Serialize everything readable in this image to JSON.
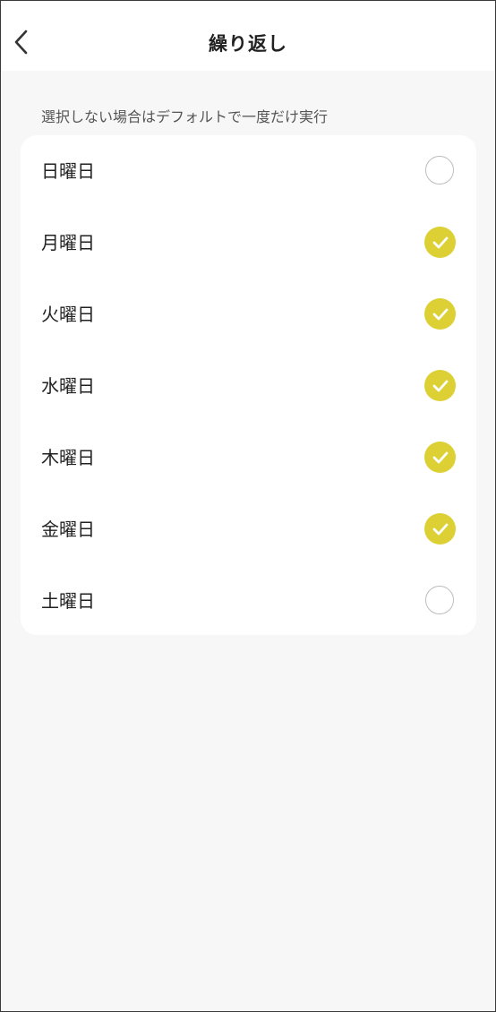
{
  "header": {
    "title": "繰り返し",
    "back_icon": "chevron-left-icon"
  },
  "hint": "選択しない場合はデフォルトで一度だけ実行",
  "colors": {
    "accent": "#ddd034",
    "background": "#f7f7f7",
    "card": "#ffffff"
  },
  "days": [
    {
      "label": "日曜日",
      "selected": false
    },
    {
      "label": "月曜日",
      "selected": true
    },
    {
      "label": "火曜日",
      "selected": true
    },
    {
      "label": "水曜日",
      "selected": true
    },
    {
      "label": "木曜日",
      "selected": true
    },
    {
      "label": "金曜日",
      "selected": true
    },
    {
      "label": "土曜日",
      "selected": false
    }
  ]
}
